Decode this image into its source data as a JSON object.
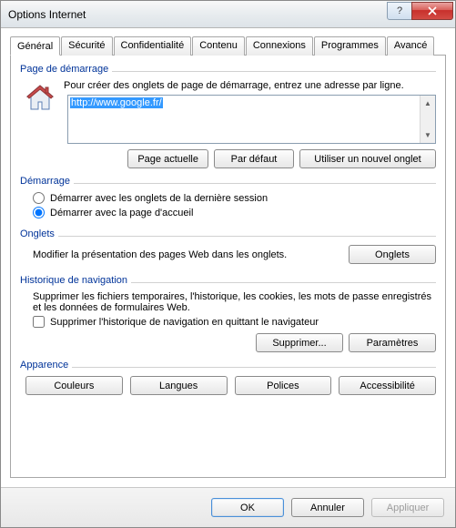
{
  "window": {
    "title": "Options Internet"
  },
  "tabs": [
    "Général",
    "Sécurité",
    "Confidentialité",
    "Contenu",
    "Connexions",
    "Programmes",
    "Avancé"
  ],
  "activeTab": 0,
  "homepage": {
    "label": "Page de démarrage",
    "desc": "Pour créer des onglets de page de démarrage, entrez une adresse par ligne.",
    "value": "http://www.google.fr/",
    "btn_current": "Page actuelle",
    "btn_default": "Par défaut",
    "btn_newtab": "Utiliser un nouvel onglet"
  },
  "startup": {
    "label": "Démarrage",
    "opt_last": "Démarrer avec les onglets de la dernière session",
    "opt_home": "Démarrer avec la page d'accueil"
  },
  "tabsGroup": {
    "label": "Onglets",
    "desc": "Modifier la présentation des pages Web dans les onglets.",
    "btn": "Onglets"
  },
  "history": {
    "label": "Historique de navigation",
    "desc": "Supprimer les fichiers temporaires, l'historique, les cookies, les mots de passe enregistrés et les données de formulaires Web.",
    "check": "Supprimer l'historique de navigation en quittant le navigateur",
    "btn_delete": "Supprimer...",
    "btn_settings": "Paramètres"
  },
  "appearance": {
    "label": "Apparence",
    "btn_colors": "Couleurs",
    "btn_langs": "Langues",
    "btn_fonts": "Polices",
    "btn_access": "Accessibilité"
  },
  "footer": {
    "ok": "OK",
    "cancel": "Annuler",
    "apply": "Appliquer"
  }
}
